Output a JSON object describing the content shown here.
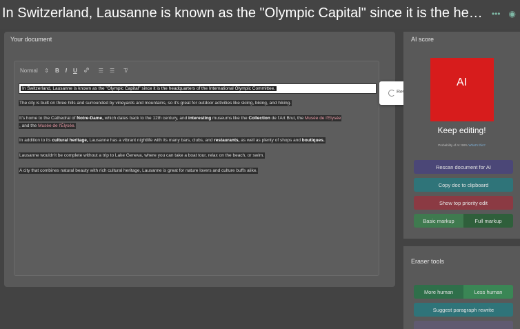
{
  "header": {
    "title": "In Switzerland, Lausanne is known as the \"Olympic Capital\" since it is the head...",
    "more_icon": "•••",
    "circle_icon": "◉"
  },
  "document": {
    "label": "Your document",
    "toolbar": {
      "format_select": "Normal",
      "select_arrow": "⇕",
      "bold": "B",
      "italic": "I",
      "underline": "U",
      "link_icon": "🔗",
      "ordered_list": "☰",
      "bullet_list": "☰",
      "clear_format": "T̸"
    },
    "first_sentence": "In Switzerland, Lausanne is known as the \"Olympic Capital\" since it is the headquarters of the International Olympic Committee.",
    "p2": "The city is built on three hills and  surrounded by vineyards and mountains, so it's great for outdoor activities like skiing, biking, and hiking.",
    "p3": {
      "a": "It's home to the Cathedral of ",
      "b": "Notre-Dame,",
      "c": " which dates back to the 12th century, and ",
      "d": "interesting",
      "e": " museums like the ",
      "f": "Collection",
      "g": " de l'Art Brut, the ",
      "h": "Musée de l'Elysée",
      "i": ", and the ",
      "j": "Musée de l'Élysée."
    },
    "p4": {
      "a": "In addition to its ",
      "b": "cultural",
      "c": " ",
      "d": "heritage,",
      "e": " Lausanne has a vibrant nightlife with its many bars, clubs, and ",
      "f": "restaurants,",
      "g": " as well  as plenty of shops and ",
      "h": "boutiques."
    },
    "p5": "Lausanne  wouldn't be complete without a trip to Lake Geneva, where you can take  a boat tour, relax on the beach, or swim.",
    "p6": "A city that combines natural beauty with rich cultural heritage, Lausanne is great for nature lovers and culture  buffs alike."
  },
  "popup": {
    "text": "Rewriting this..."
  },
  "ai_score": {
    "label": "AI score",
    "score_text": "AI",
    "status": "Keep editing!",
    "probability": "Probability of AI: 98%",
    "probability_link": "What's this?",
    "score_color": "#d71c1c"
  },
  "actions": {
    "rescan": "Rescan document for AI",
    "copy": "Copy doc to clipboard",
    "priority": "Show top priority edit",
    "basic_markup": "Basic markup",
    "full_markup": "Full markup"
  },
  "eraser": {
    "label": "Eraser tools",
    "more_human": "More human",
    "less_human": "Less human",
    "suggest": "Suggest paragraph rewrite"
  }
}
